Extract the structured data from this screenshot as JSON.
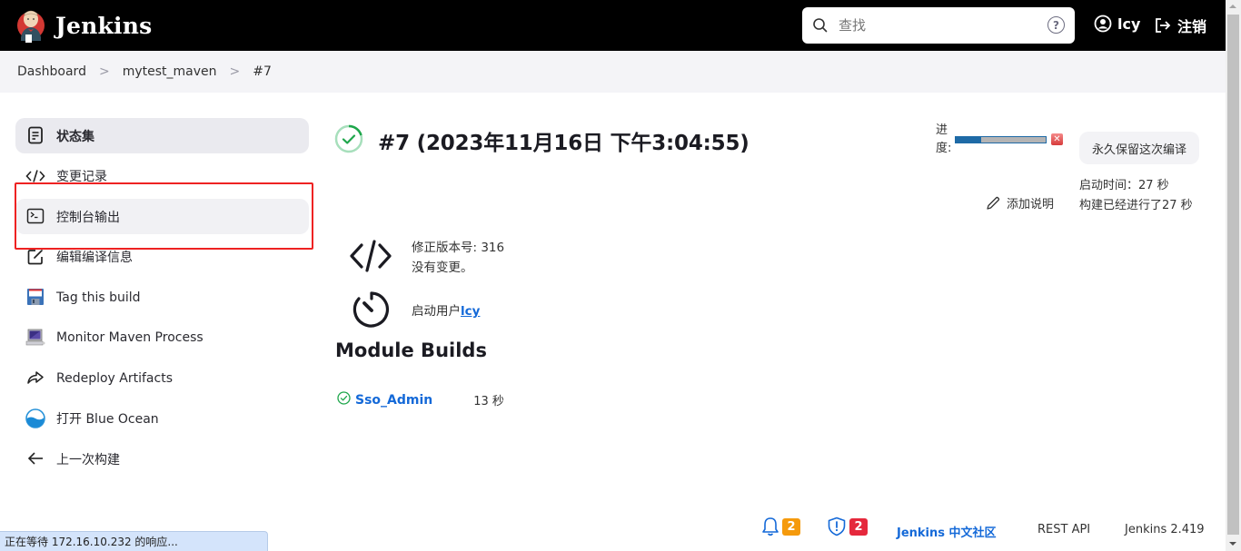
{
  "header": {
    "app_name": "Jenkins",
    "search_placeholder": "查找",
    "help_label": "?",
    "user_name": "lcy",
    "logout_label": "注销"
  },
  "breadcrumb": {
    "items": [
      "Dashboard",
      "mytest_maven",
      "#7"
    ],
    "separator": ">"
  },
  "sidebar": {
    "items": [
      {
        "label": "状态集",
        "icon": "document-icon",
        "active": true
      },
      {
        "label": "变更记录",
        "icon": "code-icon"
      },
      {
        "label": "控制台输出",
        "icon": "terminal-icon",
        "highlighted": true
      },
      {
        "label": "编辑编译信息",
        "icon": "edit-icon"
      },
      {
        "label": "Tag this build",
        "icon": "floppy-disk-icon"
      },
      {
        "label": "Monitor Maven Process",
        "icon": "computer-icon"
      },
      {
        "label": "Redeploy Artifacts",
        "icon": "redeploy-arrow-icon"
      },
      {
        "label": "打开 Blue Ocean",
        "icon": "blue-ocean-icon"
      },
      {
        "label": "上一次构建",
        "icon": "arrow-left-icon"
      }
    ]
  },
  "build": {
    "title": "#7 (2023年11月16日 下午3:04:55)",
    "status": "success",
    "progress_label": "进度:",
    "progress_percent": 28,
    "keep_button": "永久保留这次编译",
    "start_time": "启动时间：27 秒",
    "elapsed": "构建已经进行了27 秒",
    "add_description": "添加说明",
    "revision": "修正版本号: 316",
    "no_changes": "没有变更。",
    "started_by_prefix": "启动用户",
    "started_by_user": "lcy"
  },
  "modules": {
    "title": "Module Builds",
    "items": [
      {
        "name": "Sso_Admin",
        "duration": "13 秒",
        "status": "success"
      }
    ]
  },
  "footer": {
    "notifications_count": "2",
    "security_count": "2",
    "community_link": "Jenkins 中文社区",
    "rest_api": "REST API",
    "version": "Jenkins 2.419"
  },
  "statusbar": {
    "text": "正在等待 172.16.10.232 的响应..."
  },
  "colors": {
    "link": "#1469d8",
    "success": "#1ea64b",
    "highlight": "#ee2222",
    "progress": "#1e6aa6",
    "badge_orange": "#f59a0c",
    "badge_red": "#e5283c"
  }
}
